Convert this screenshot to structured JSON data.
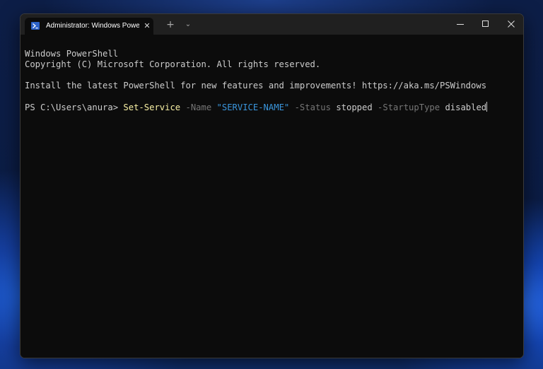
{
  "window": {
    "tab_title": "Administrator: Windows PowerShell",
    "tab_close_glyph": "✕",
    "new_tab_glyph": "+",
    "dropdown_glyph": "⌄"
  },
  "terminal": {
    "lines": {
      "l1": "Windows PowerShell",
      "l2": "Copyright (C) Microsoft Corporation. All rights reserved.",
      "l3": "Install the latest PowerShell for new features and improvements! https://aka.ms/PSWindows"
    },
    "prompt": "PS C:\\Users\\anura> ",
    "command": {
      "cmdlet": "Set-Service",
      "param_name": "-Name",
      "name_value": "\"SERVICE-NAME\"",
      "param_status": "-Status",
      "status_value": "stopped",
      "param_startup": "-StartupType",
      "startup_value": "disabled"
    }
  },
  "colors": {
    "terminal_bg": "#0c0c0c",
    "text": "#cccccc",
    "cmdlet": "#f9f1a5",
    "parameter": "#767676",
    "string": "#3a96dd",
    "titlebar": "#202020"
  },
  "icons": {
    "tab": "powershell-icon",
    "close": "close-icon",
    "minimize": "minimize-icon",
    "maximize": "maximize-icon"
  }
}
